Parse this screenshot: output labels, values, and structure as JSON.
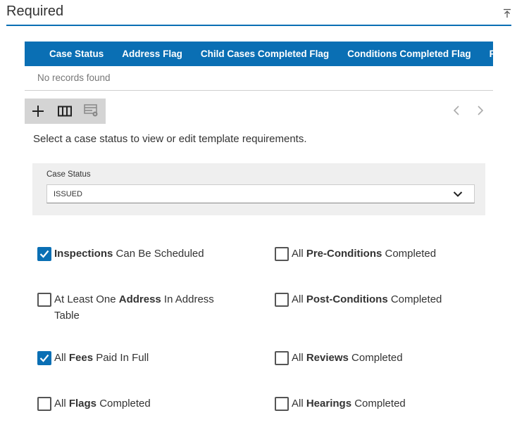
{
  "section": {
    "title": "Required"
  },
  "grid": {
    "columns": [
      "Case Status",
      "Address Flag",
      "Child Cases Completed Flag",
      "Conditions Completed Flag",
      "Fees"
    ],
    "empty_message": "No records found"
  },
  "toolbar": {
    "icons": [
      "plus-icon",
      "columns-icon",
      "settings-table-icon"
    ]
  },
  "instructions": "Select a case status to view or edit template requirements.",
  "status": {
    "label": "Case Status",
    "value": "ISSUED"
  },
  "requirements": [
    {
      "pre": "",
      "bold": "Inspections",
      "post": " Can Be Scheduled",
      "checked": true
    },
    {
      "pre": "All ",
      "bold": "Pre-Conditions",
      "post": " Completed",
      "checked": false
    },
    {
      "pre": "At Least One ",
      "bold": "Address",
      "post": " In Address Table",
      "checked": false
    },
    {
      "pre": "All ",
      "bold": "Post-Conditions",
      "post": " Completed",
      "checked": false
    },
    {
      "pre": "All ",
      "bold": "Fees",
      "post": " Paid In Full",
      "checked": true
    },
    {
      "pre": "All ",
      "bold": "Reviews",
      "post": " Completed",
      "checked": false
    },
    {
      "pre": "All ",
      "bold": "Flags",
      "post": " Completed",
      "checked": false
    },
    {
      "pre": "All ",
      "bold": "Hearings",
      "post": " Completed",
      "checked": false
    }
  ],
  "colors": {
    "accent": "#0a6fb4",
    "toolbar_bg": "#d4d4d4",
    "panel_bg": "#efefef"
  }
}
